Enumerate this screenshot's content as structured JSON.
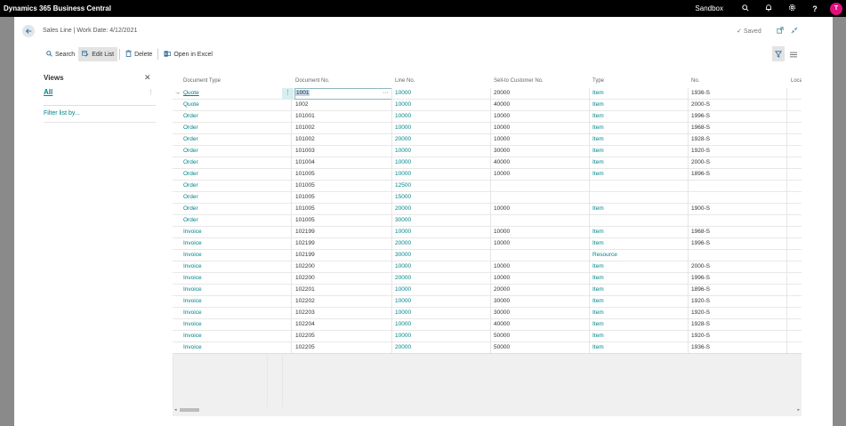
{
  "topbar": {
    "app_title": "Dynamics 365 Business Central",
    "environment": "Sandbox",
    "avatar_initial": "T",
    "icons": [
      "search-icon",
      "bell-icon",
      "gear-icon",
      "help-icon"
    ]
  },
  "header": {
    "page_title": "Sales Line | Work Date: 4/12/2021",
    "saved_label": "Saved"
  },
  "actions": {
    "search": "Search",
    "edit_list": "Edit List",
    "delete": "Delete",
    "open_in_excel": "Open in Excel"
  },
  "views": {
    "title": "Views",
    "all": "All",
    "filter_link": "Filter list by..."
  },
  "grid": {
    "columns": [
      "Document Type",
      "Document No.",
      "Line No.",
      "Sell-to Customer No.",
      "Type",
      "No.",
      "Loca"
    ],
    "rows": [
      [
        "Quote",
        "1001",
        "10000",
        "20000",
        "Item",
        "1936-S"
      ],
      [
        "Quote",
        "1002",
        "10000",
        "40000",
        "Item",
        "2000-S"
      ],
      [
        "Order",
        "101001",
        "10000",
        "10000",
        "Item",
        "1996-S"
      ],
      [
        "Order",
        "101002",
        "10000",
        "10000",
        "Item",
        "1968-S"
      ],
      [
        "Order",
        "101002",
        "20000",
        "10000",
        "Item",
        "1928-S"
      ],
      [
        "Order",
        "101003",
        "10000",
        "30000",
        "Item",
        "1920-S"
      ],
      [
        "Order",
        "101004",
        "10000",
        "40000",
        "Item",
        "2000-S"
      ],
      [
        "Order",
        "101005",
        "10000",
        "10000",
        "Item",
        "1896-S"
      ],
      [
        "Order",
        "101005",
        "12500",
        "",
        "",
        ""
      ],
      [
        "Order",
        "101005",
        "15000",
        "",
        "",
        ""
      ],
      [
        "Order",
        "101005",
        "20000",
        "10000",
        "Item",
        "1900-S"
      ],
      [
        "Order",
        "101005",
        "30000",
        "",
        "",
        ""
      ],
      [
        "Invoice",
        "102199",
        "10000",
        "10000",
        "Item",
        "1968-S"
      ],
      [
        "Invoice",
        "102199",
        "20000",
        "10000",
        "Item",
        "1996-S"
      ],
      [
        "Invoice",
        "102199",
        "30000",
        "",
        "Resource",
        ""
      ],
      [
        "Invoice",
        "102200",
        "10000",
        "10000",
        "Item",
        "2000-S"
      ],
      [
        "Invoice",
        "102200",
        "20000",
        "10000",
        "Item",
        "1996-S"
      ],
      [
        "Invoice",
        "102201",
        "10000",
        "20000",
        "Item",
        "1896-S"
      ],
      [
        "Invoice",
        "102202",
        "10000",
        "30000",
        "Item",
        "1920-S"
      ],
      [
        "Invoice",
        "102203",
        "10000",
        "30000",
        "Item",
        "1920-S"
      ],
      [
        "Invoice",
        "102204",
        "10000",
        "40000",
        "Item",
        "1928-S"
      ],
      [
        "Invoice",
        "102205",
        "10000",
        "50000",
        "Item",
        "1920-S"
      ],
      [
        "Invoice",
        "102205",
        "20000",
        "50000",
        "Item",
        "1936-S"
      ]
    ]
  },
  "colors": {
    "accent": "#008489",
    "topbar": "#000000",
    "avatar": "#e0107a"
  }
}
